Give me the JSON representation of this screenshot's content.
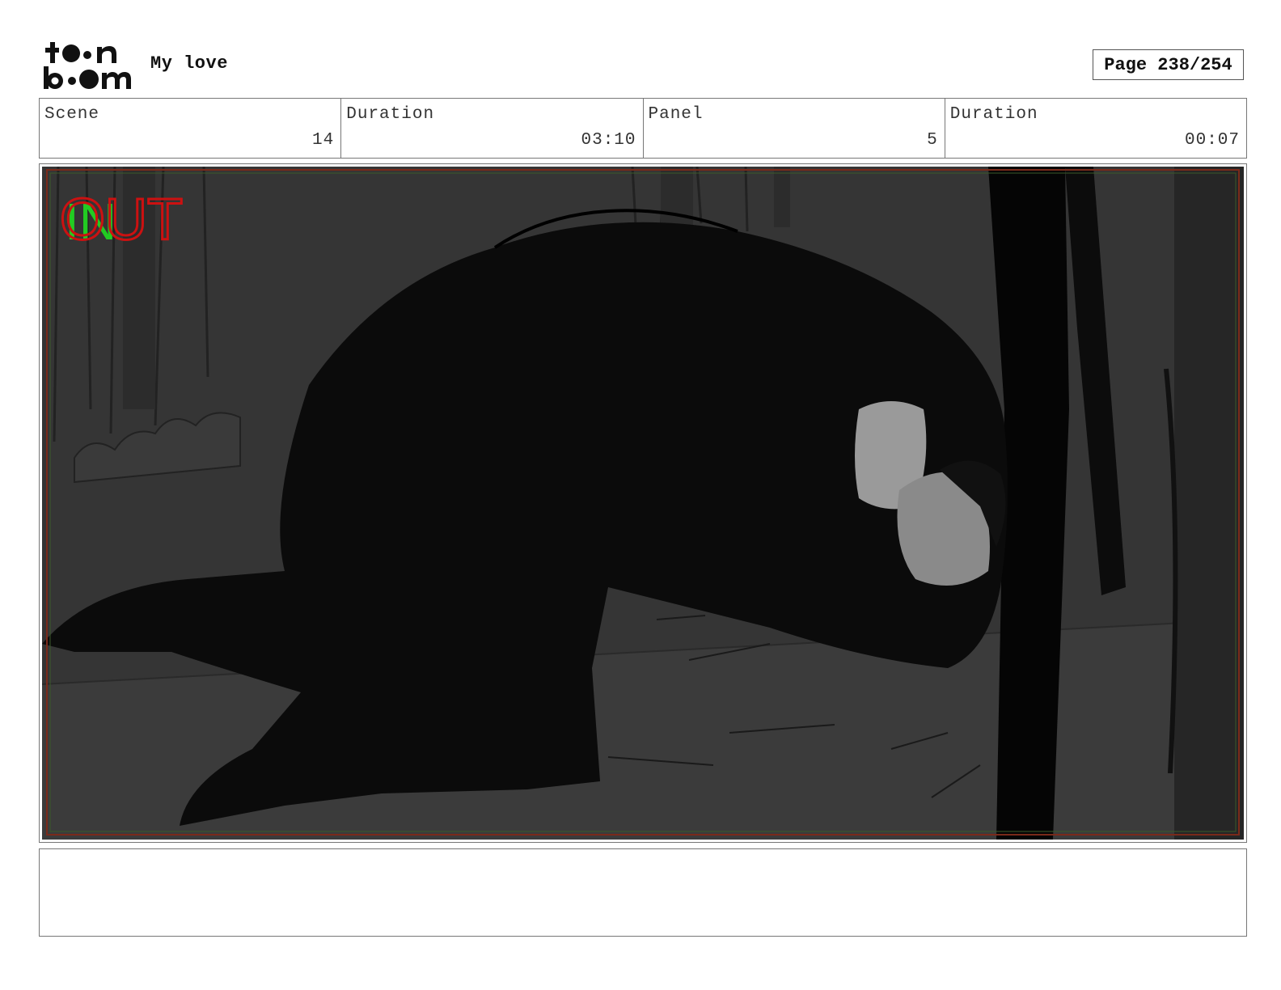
{
  "header": {
    "logo_name": "toon-boom-logo",
    "project_title": "My love",
    "page_label": "Page 238/254"
  },
  "info": {
    "scene_label": "Scene",
    "scene_value": "14",
    "scene_duration_label": "Duration",
    "scene_duration_value": "03:10",
    "panel_label": "Panel",
    "panel_value": "5",
    "panel_duration_label": "Duration",
    "panel_duration_value": "00:07"
  },
  "panel": {
    "overlay_in": "IN",
    "overlay_out": "OUT",
    "overlay_in_color": "#22cc22",
    "overlay_out_color": "#cc1111",
    "background_color": "#333333"
  },
  "notes": {
    "text": ""
  }
}
